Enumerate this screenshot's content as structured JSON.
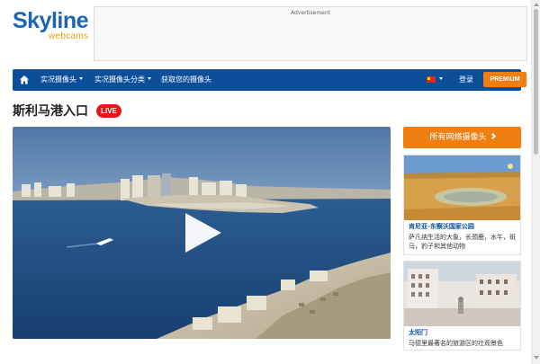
{
  "logo": {
    "main": "Skyline",
    "sub": "webcams"
  },
  "ad": {
    "label": "Advertisement"
  },
  "nav": {
    "items": [
      {
        "label": "实况摄像头",
        "has_caret": true
      },
      {
        "label": "实况摄像头分类",
        "has_caret": true
      },
      {
        "label": "获取您的摄像头",
        "has_caret": false
      }
    ],
    "login": "登录",
    "premium": "PREMIUM",
    "home_icon": "home-icon",
    "language_flag": "china-flag-icon"
  },
  "page": {
    "title": "斯利马港入口",
    "live_badge": "LIVE"
  },
  "video": {
    "play_icon": "play-icon"
  },
  "sidebar": {
    "all_cams_button": "所有网络摄像头",
    "cams": [
      {
        "name": "肯尼亚-东察沃国家公园",
        "desc": "萨凡纳生活的大象，长颈鹿，水牛，斑马，豹子和其他动物"
      },
      {
        "name": "太阳门",
        "desc": "马德里最著名的旅游区的壮观景色"
      }
    ]
  },
  "colors": {
    "brand_blue": "#0b4f9b",
    "accent_orange": "#f07f12",
    "live_red": "#e4151b",
    "logo_gold": "#e8a000"
  }
}
